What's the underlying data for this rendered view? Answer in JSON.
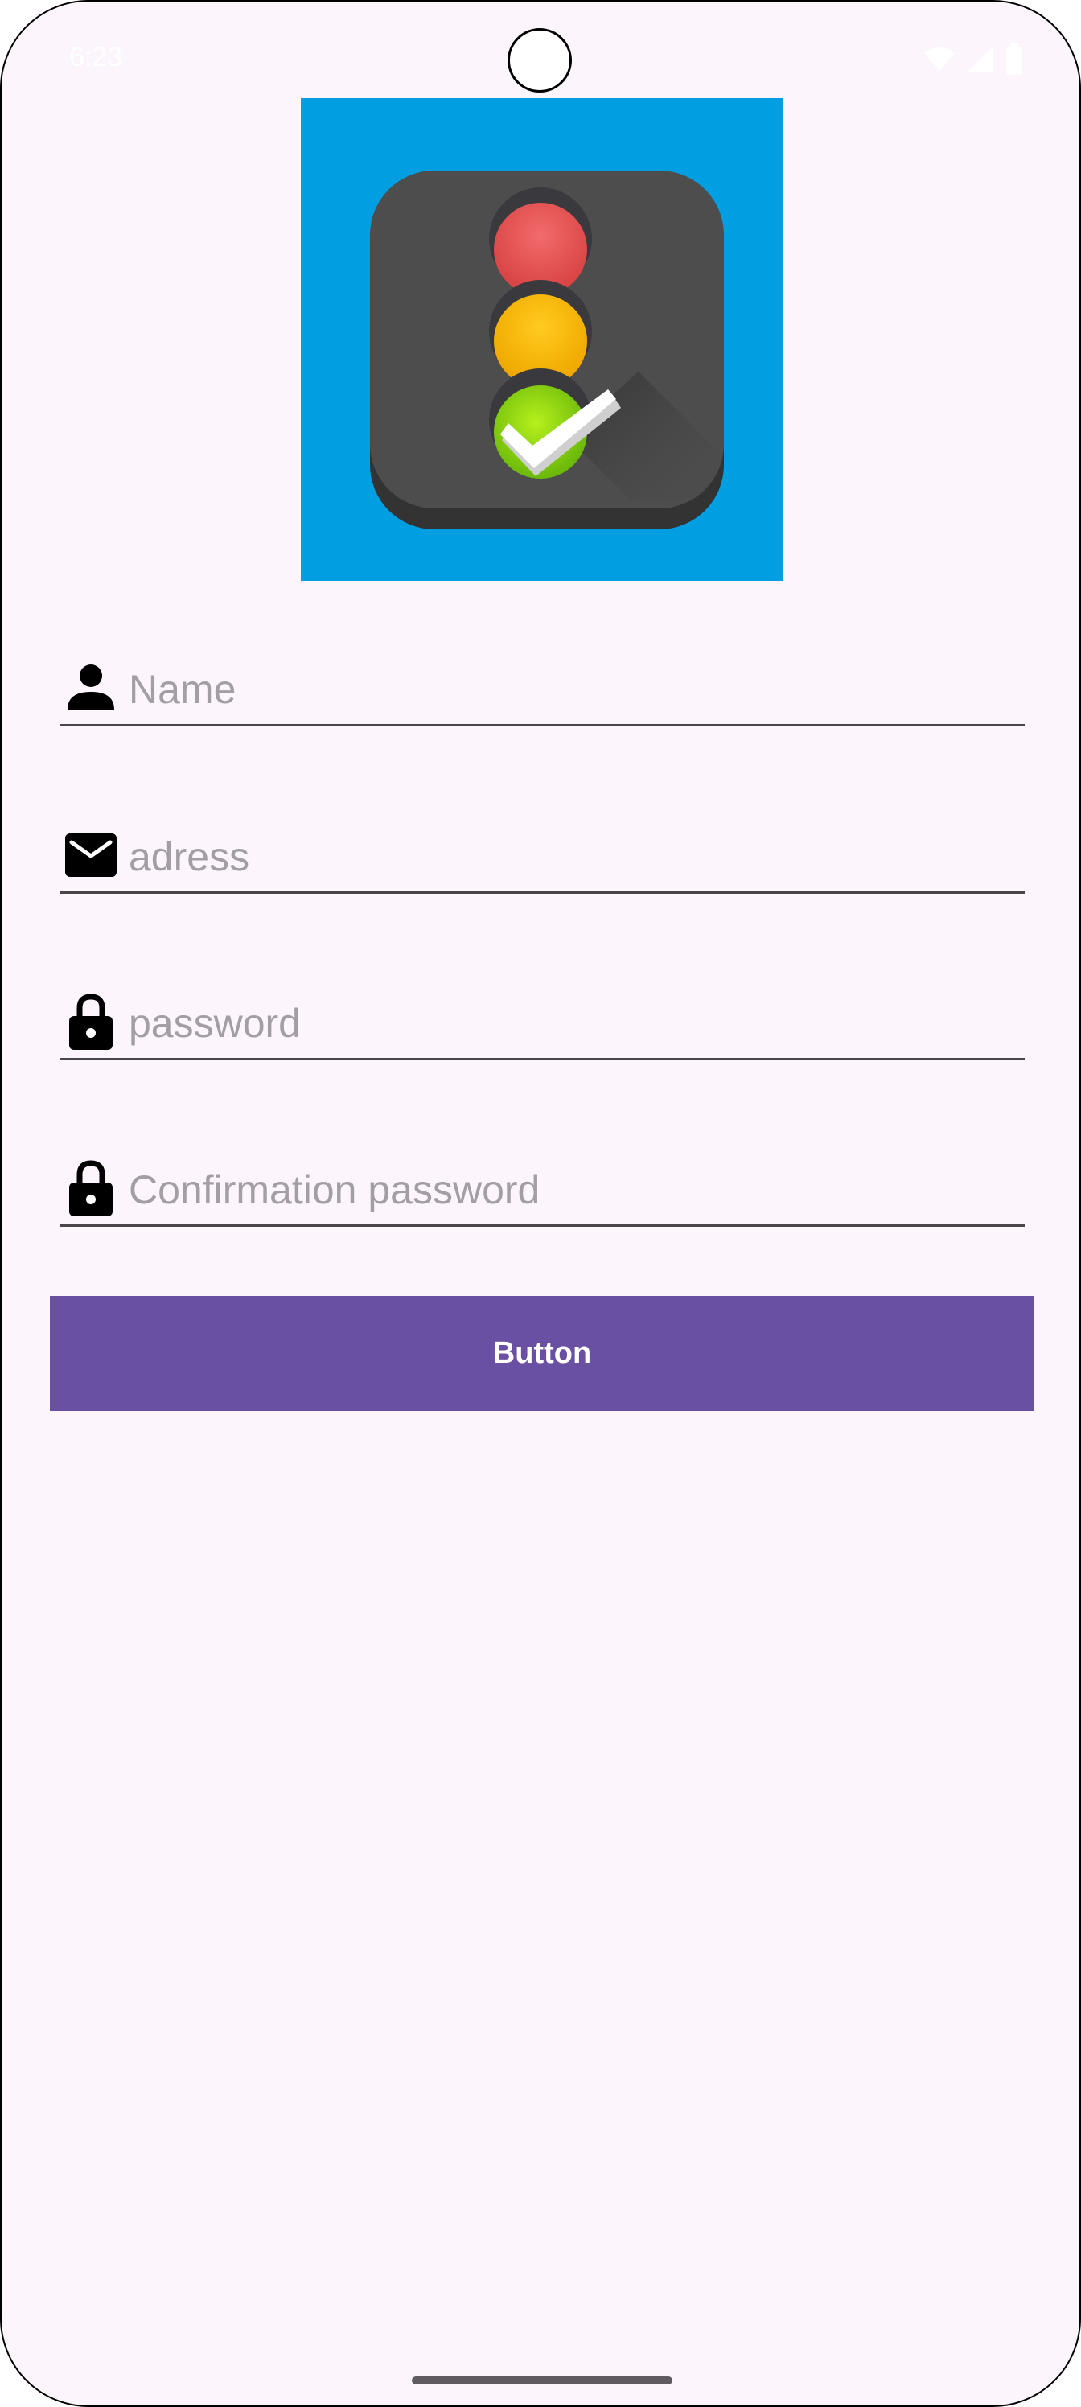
{
  "status_bar": {
    "time": "6:23",
    "icons": [
      "wifi-icon",
      "cellular-signal-icon",
      "battery-icon"
    ]
  },
  "logo": {
    "icon": "traffic-light-check-icon",
    "background_color": "#019fe1"
  },
  "form": {
    "name": {
      "placeholder": "Name",
      "value": "",
      "icon": "person-icon"
    },
    "address": {
      "placeholder": "adress",
      "value": "",
      "icon": "email-icon"
    },
    "password": {
      "placeholder": "password",
      "value": "",
      "icon": "lock-icon"
    },
    "confirm_password": {
      "placeholder": "Confirmation password",
      "value": "",
      "icon": "lock-icon"
    }
  },
  "submit_button": {
    "label": "Button",
    "color": "#6a50a3"
  },
  "theme": {
    "background": "#fcf5fc",
    "underline": "#4a4548",
    "placeholder_color": "#a39ea3"
  }
}
